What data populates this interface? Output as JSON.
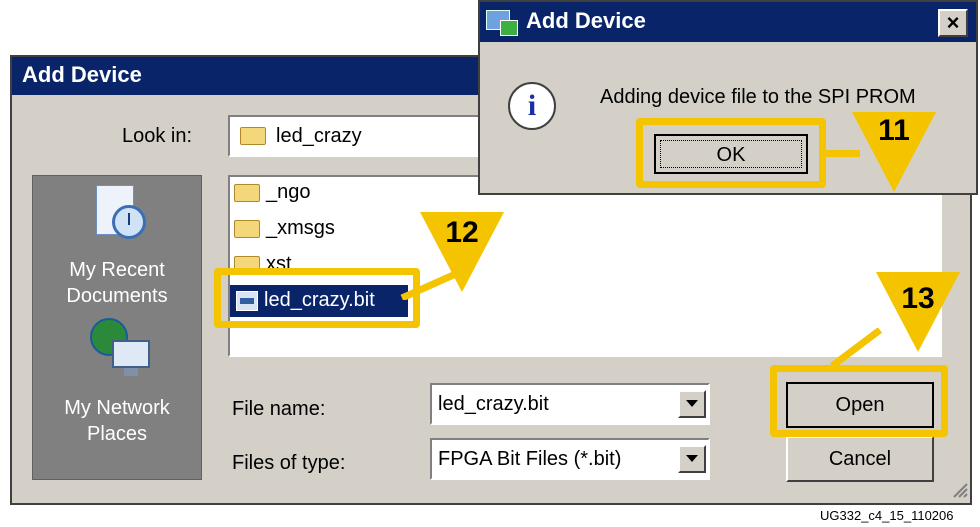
{
  "dialog": {
    "title": "Add Device",
    "look_in_label": "Look in:",
    "look_in_value": "led_crazy",
    "places": [
      {
        "label_line1": "My Recent",
        "label_line2": "Documents",
        "icon": "recent-documents-icon"
      },
      {
        "label_line1": "My Network",
        "label_line2": "Places",
        "icon": "network-places-icon"
      }
    ],
    "files": [
      {
        "name": "_ngo",
        "type": "folder"
      },
      {
        "name": "_xmsgs",
        "type": "folder"
      },
      {
        "name": "xst",
        "type": "folder"
      },
      {
        "name": "led_crazy.bit",
        "type": "file",
        "selected": true
      }
    ],
    "file_name_label": "File name:",
    "file_name_value": "led_crazy.bit",
    "file_type_label": "Files of type:",
    "file_type_value": "FPGA Bit Files (*.bit)",
    "open_label": "Open",
    "cancel_label": "Cancel"
  },
  "message_box": {
    "title": "Add Device",
    "close_glyph": "×",
    "text": "Adding device file to the SPI PROM",
    "ok_label": "OK",
    "info_glyph": "i"
  },
  "callouts": [
    "11",
    "12",
    "13"
  ],
  "caption": "UG332_c4_15_110206",
  "colors": {
    "highlight": "#f5c400",
    "titlebar": "#0a246a",
    "selection": "#0a246a",
    "dialog_bg": "#d4d0c8"
  }
}
